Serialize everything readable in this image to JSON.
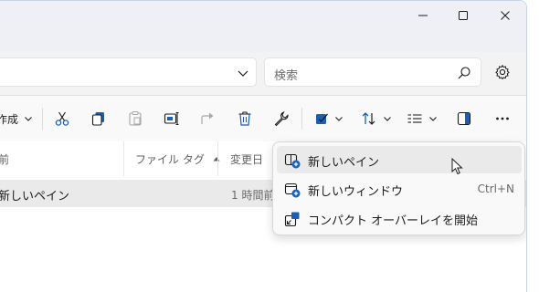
{
  "search": {
    "placeholder": "検索"
  },
  "toolbar": {
    "new_label": "作成"
  },
  "columns": {
    "name": "前",
    "tags": "ファイル タグ",
    "modified": "変更日"
  },
  "rows": [
    {
      "name": "新しいペイン",
      "modified": "1 時間前"
    }
  ],
  "menu": {
    "items": [
      {
        "label": "新しいペイン",
        "shortcut": ""
      },
      {
        "label": "新しいウィンドウ",
        "shortcut": "Ctrl+N"
      },
      {
        "label": "コンパクト オーバーレイを開始",
        "shortcut": ""
      }
    ]
  },
  "colors": {
    "accent": "#1a5fb4",
    "hover": "#eaeaea"
  }
}
